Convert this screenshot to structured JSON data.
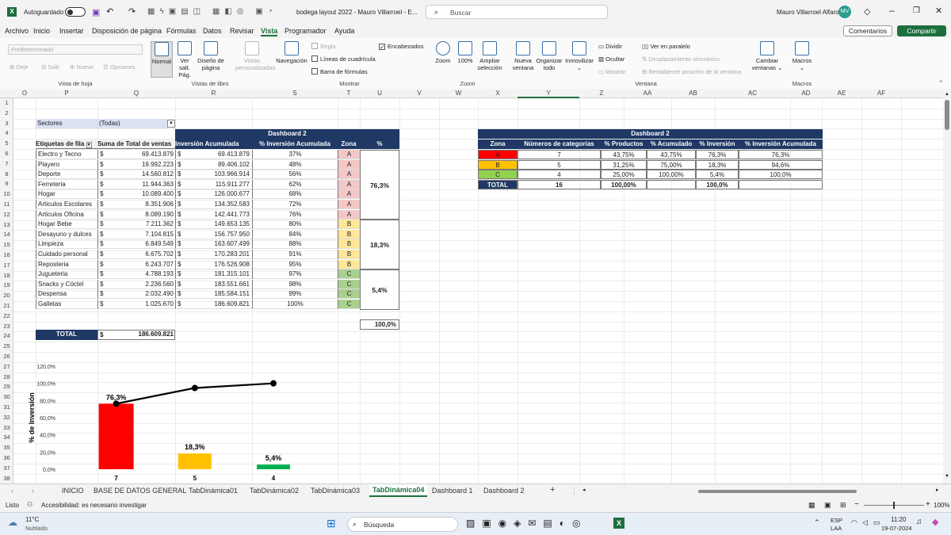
{
  "window": {
    "autosave_label": "Autoguardado",
    "autosave_state": "off",
    "file_title": "bodega layout 2022 - Mauro Villarroel - E...",
    "search_placeholder": "Buscar",
    "user_name": "Mauro Villarroel Alfaro",
    "user_initials": "MV"
  },
  "menu": {
    "items": [
      "Archivo",
      "Inicio",
      "Insertar",
      "Disposición de página",
      "Fórmulas",
      "Datos",
      "Revisar",
      "Vista",
      "Programador",
      "Ayuda"
    ],
    "active": "Vista",
    "comments_label": "Comentarios",
    "share_label": "Compartir"
  },
  "ribbon": {
    "sheet_view": {
      "dropdown": "Predeterminado",
      "keep": "Deje",
      "exit": "Salir",
      "new": "Nuevo",
      "options": "Opciones",
      "label": "Vista de hoja"
    },
    "book_views": {
      "normal": "Normal",
      "page_break": "Ver salt. Pág.",
      "page_layout": "Diseño de página",
      "custom": "Vistas personalizadas",
      "label": "Vistas de libro"
    },
    "show": {
      "navigation": "Navegación",
      "ruler": "Regla",
      "gridlines": "Líneas de cuadrícula",
      "formula_bar": "Barra de fórmulas",
      "headings": "Encabezados",
      "label": "Mostrar"
    },
    "zoom": {
      "zoom": "Zoom",
      "hundred": "100%",
      "fit": "Ampliar selección",
      "label": "Zoom"
    },
    "window": {
      "new_window": "Nueva ventana",
      "arrange": "Organizar todo",
      "freeze": "Inmovilizar",
      "split": "Dividir",
      "hide": "Ocultar",
      "unhide": "Mostrar",
      "side_by_side": "Ver en paralelo",
      "sync_scroll": "Desplazamiento sincrónico",
      "reset_pos": "Restablecer posición de la ventana",
      "switch": "Cambiar ventanas",
      "label": "Ventana"
    },
    "macros": {
      "macros": "Macros",
      "label": "Macros"
    }
  },
  "columns": [
    "O",
    "P",
    "Q",
    "R",
    "S",
    "T",
    "U",
    "V",
    "W",
    "X",
    "Y",
    "Z",
    "AA",
    "AB",
    "AC",
    "AD",
    "AE",
    "AF"
  ],
  "rows": [
    "1",
    "2",
    "3",
    "4",
    "5",
    "6",
    "7",
    "8",
    "9",
    "10",
    "11",
    "12",
    "13",
    "14",
    "15",
    "16",
    "17",
    "18",
    "19",
    "20",
    "21",
    "22",
    "23",
    "24",
    "25",
    "26",
    "27",
    "28",
    "29",
    "30",
    "31",
    "32",
    "33",
    "34",
    "35",
    "36",
    "37",
    "38"
  ],
  "pivot": {
    "filter_label": "Sectores",
    "filter_value": "(Todas)",
    "dashboard_title": "Dashboard 2",
    "headers": [
      "Etiquetas de fila",
      "Suma de Total de ventas",
      "Inversión Acumulada",
      "% Inversión Acumulada",
      "Zona",
      "%"
    ],
    "currency": "$",
    "rows": [
      {
        "label": "Electro y Tecno",
        "total": "69.413.879",
        "acum": "69.413.879",
        "pct": "37%",
        "zona": "A"
      },
      {
        "label": "Playero",
        "total": "19.992.223",
        "acum": "89.406.102",
        "pct": "48%",
        "zona": "A"
      },
      {
        "label": "Deporte",
        "total": "14.560.812",
        "acum": "103.966.914",
        "pct": "56%",
        "zona": "A"
      },
      {
        "label": "Ferreteria",
        "total": "11.944.363",
        "acum": "115.911.277",
        "pct": "62%",
        "zona": "A"
      },
      {
        "label": "Hogar",
        "total": "10.089.400",
        "acum": "126.000.677",
        "pct": "68%",
        "zona": "A"
      },
      {
        "label": "Articulos Escolares",
        "total": "8.351.906",
        "acum": "134.352.583",
        "pct": "72%",
        "zona": "A"
      },
      {
        "label": "Articulos Oficina",
        "total": "8.089.190",
        "acum": "142.441.773",
        "pct": "76%",
        "zona": "A"
      },
      {
        "label": "Hogar Bebe",
        "total": "7.211.362",
        "acum": "149.653.135",
        "pct": "80%",
        "zona": "B"
      },
      {
        "label": "Desayuno y dulces",
        "total": "7.104.815",
        "acum": "156.757.950",
        "pct": "84%",
        "zona": "B"
      },
      {
        "label": "Limpieza",
        "total": "6.849.549",
        "acum": "163.607.499",
        "pct": "88%",
        "zona": "B"
      },
      {
        "label": "Cuidado personal",
        "total": "6.675.702",
        "acum": "170.283.201",
        "pct": "91%",
        "zona": "B"
      },
      {
        "label": "Reposteria",
        "total": "6.243.707",
        "acum": "176.526.908",
        "pct": "95%",
        "zona": "B"
      },
      {
        "label": "Jugueteria",
        "total": "4.788.193",
        "acum": "181.315.101",
        "pct": "97%",
        "zona": "C"
      },
      {
        "label": "Snacks y Cóctel",
        "total": "2.236.560",
        "acum": "183.551.661",
        "pct": "98%",
        "zona": "C"
      },
      {
        "label": "Despensa",
        "total": "2.032.490",
        "acum": "185.584.151",
        "pct": "99%",
        "zona": "C"
      },
      {
        "label": "Galletas",
        "total": "1.025.670",
        "acum": "186.609.821",
        "pct": "100%",
        "zona": "C"
      }
    ],
    "zone_pct": {
      "A": "76,3%",
      "B": "18,3%",
      "C": "5,4%"
    },
    "zone_total": "100,0%",
    "total_label": "TOTAL",
    "total_value": "186.609.821"
  },
  "summary": {
    "title": "Dashboard 2",
    "headers": [
      "Zona",
      "Números de categorias",
      "% Productos",
      "% Acumulado",
      "% Inversión",
      "% Inversión Acumulada"
    ],
    "rows": [
      {
        "zona": "A",
        "n": "7",
        "prod": "43,75%",
        "acum": "43,75%",
        "inv": "76,3%",
        "inv_acum": "76,3%",
        "color": "#ff0000"
      },
      {
        "zona": "B",
        "n": "5",
        "prod": "31,25%",
        "acum": "75,00%",
        "inv": "18,3%",
        "inv_acum": "94,6%",
        "color": "#ffc000"
      },
      {
        "zona": "C",
        "n": "4",
        "prod": "25,00%",
        "acum": "100,00%",
        "inv": "5,4%",
        "inv_acum": "100,0%",
        "color": "#92d050"
      }
    ],
    "total": {
      "label": "TOTAL",
      "n": "16",
      "prod": "100,00%",
      "inv": "100,0%"
    }
  },
  "chart_data": {
    "type": "bar",
    "categories": [
      "7",
      "5",
      "4"
    ],
    "series": [
      {
        "type": "bar",
        "values": [
          76.3,
          18.3,
          5.4
        ],
        "colors": [
          "#ff0000",
          "#ffc000",
          "#00b050"
        ],
        "labels": [
          "76,3%",
          "18,3%",
          "5,4%"
        ]
      },
      {
        "type": "line",
        "values": [
          76.3,
          94.6,
          100.0
        ]
      }
    ],
    "ylabel": "% de Inversión",
    "yticks": [
      "0,0%",
      "20,0%",
      "40,0%",
      "60,0%",
      "80,0%",
      "100,0%",
      "120,0%"
    ],
    "ylim": [
      0,
      120
    ]
  },
  "sheets": {
    "tabs": [
      "INICIO",
      "BASE DE DATOS GENERAL",
      "TabDinámica01",
      "TabDinámica02",
      "TabDinámica03",
      "TabDinámica04",
      "Dashboard 1",
      "Dashboard 2"
    ],
    "active": "TabDinámica04"
  },
  "status": {
    "ready": "Listo",
    "accessibility": "Accesibilidad: es necesario investigar",
    "zoom": "100%"
  },
  "taskbar": {
    "temp": "11°C",
    "weather": "Nublado",
    "search": "Búsqueda",
    "lang1": "ESP",
    "lang2": "LAA",
    "time": "11:20",
    "date": "19-07-2024"
  }
}
